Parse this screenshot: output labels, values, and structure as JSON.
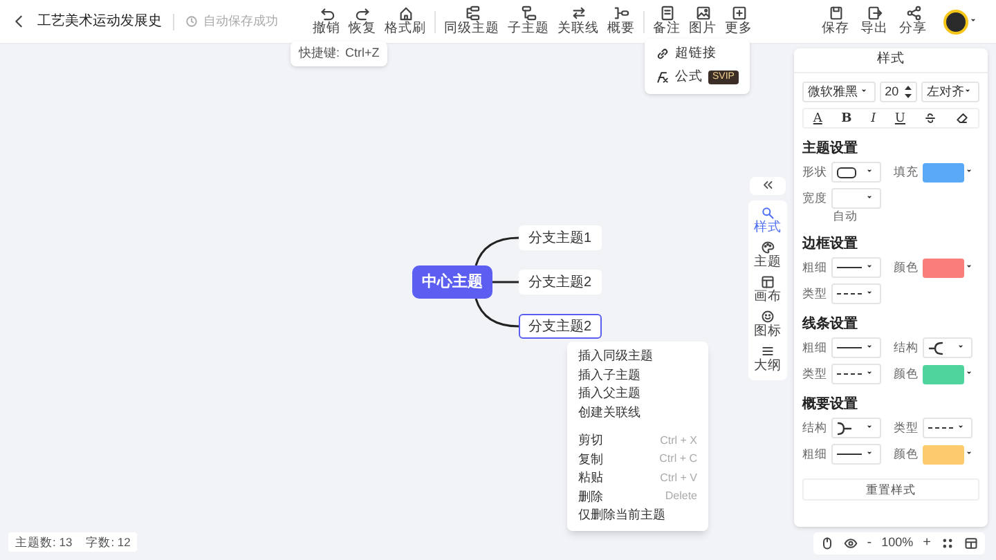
{
  "document": {
    "title": "工艺美术运动发展史",
    "save_status": "自动保存成功"
  },
  "toolbar": [
    [
      "撤销",
      "恢复",
      "格式刷"
    ],
    [
      "同级主题",
      "子主题",
      "关联线",
      "概要"
    ],
    [
      "备注",
      "图片",
      "更多"
    ]
  ],
  "tooltip": {
    "label": "快捷键:",
    "keys": "Ctrl+Z"
  },
  "more_menu": [
    {
      "label": "超链接"
    },
    {
      "label": "公式",
      "badge": "SVIP"
    }
  ],
  "actions": [
    "保存",
    "导出",
    "分享"
  ],
  "mind_map": {
    "root": "中心主题",
    "branches": [
      {
        "label": "分支主题1",
        "selected": false
      },
      {
        "label": "分支主题2",
        "selected": false
      },
      {
        "label": "分支主题2",
        "selected": true
      }
    ]
  },
  "context_menu": [
    [
      {
        "label": "插入同级主题"
      },
      {
        "label": "插入子主题"
      },
      {
        "label": "插入父主题"
      },
      {
        "label": "创建关联线"
      }
    ],
    [
      {
        "label": "剪切",
        "shortcut": "Ctrl + X"
      },
      {
        "label": "复制",
        "shortcut": "Ctrl + C"
      },
      {
        "label": "粘贴",
        "shortcut": "Ctrl + V"
      },
      {
        "label": "删除",
        "shortcut": "Delete"
      },
      {
        "label": "仅删除当前主题"
      }
    ]
  ],
  "side_tabs": [
    {
      "label": "样式",
      "selected": true
    },
    {
      "label": "主题",
      "selected": false
    },
    {
      "label": "画布",
      "selected": false
    },
    {
      "label": "图标",
      "selected": false
    },
    {
      "label": "大纲",
      "selected": false
    }
  ],
  "style_panel": {
    "title": "样式",
    "font": "微软雅黑",
    "size": "20",
    "align": "左对齐",
    "format_buttons": [
      {
        "kind": "text",
        "label": "A"
      },
      {
        "kind": "text",
        "label": "B"
      },
      {
        "kind": "text",
        "label": "I"
      },
      {
        "kind": "text",
        "label": "U"
      },
      {
        "kind": "strike"
      },
      {
        "kind": "eraser"
      }
    ],
    "sections": [
      {
        "title": "主题设置",
        "fields": [
          {
            "label": "形状",
            "kind": "shape"
          },
          {
            "label": "填充",
            "kind": "color",
            "color": "#5aa9f7"
          },
          {
            "label": "宽度",
            "kind": "select"
          }
        ],
        "note": "自动"
      },
      {
        "title": "边框设置",
        "fields": [
          {
            "label": "粗细",
            "kind": "line"
          },
          {
            "label": "颜色",
            "kind": "color",
            "color": "#fa7d7a"
          },
          {
            "label": "类型",
            "kind": "dashed"
          }
        ]
      },
      {
        "title": "线条设置",
        "fields": [
          {
            "label": "粗细",
            "kind": "line"
          },
          {
            "label": "结构",
            "kind": "structure"
          },
          {
            "label": "类型",
            "kind": "dashed"
          },
          {
            "label": "颜色",
            "kind": "color",
            "color": "#4fd49e"
          }
        ]
      },
      {
        "title": "概要设置",
        "fields": [
          {
            "label": "结构",
            "kind": "bracket"
          },
          {
            "label": "类型",
            "kind": "dashed"
          },
          {
            "label": "粗细",
            "kind": "line"
          },
          {
            "label": "颜色",
            "kind": "color",
            "color": "#fbcb6e"
          }
        ]
      }
    ],
    "reset": "重置样式"
  },
  "status_bar": {
    "topics": "主题数: 13",
    "words": "字数: 12"
  },
  "zoom": {
    "minus": "-",
    "value": "100%",
    "plus": "+"
  }
}
